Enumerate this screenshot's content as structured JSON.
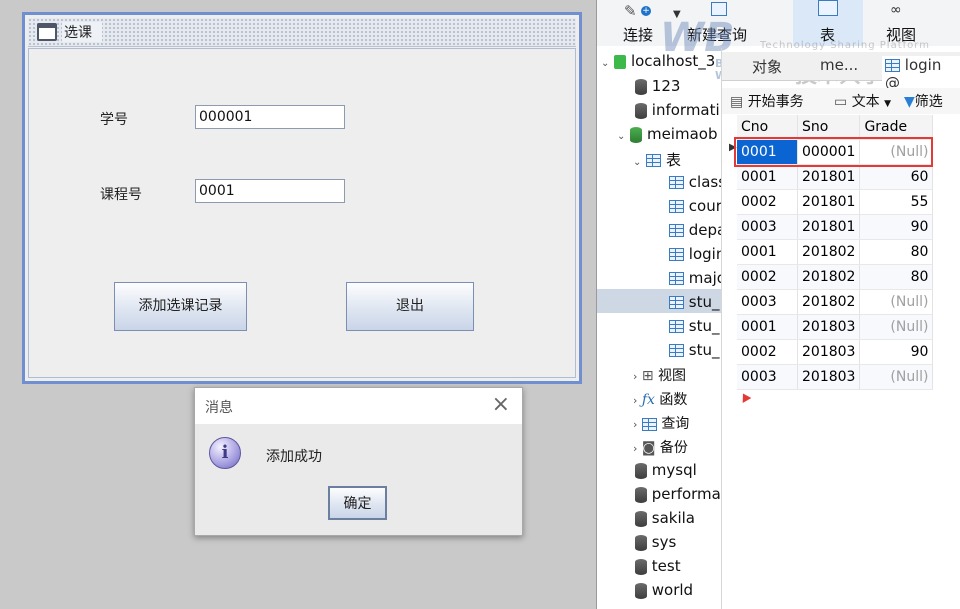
{
  "swing_window": {
    "title": "选课",
    "student_id_label": "学号",
    "student_id_value": "000001",
    "course_id_label": "课程号",
    "course_id_value": "0001",
    "add_button": "添加选课记录",
    "exit_button": "退出"
  },
  "message_dialog": {
    "title": "消息",
    "close_glyph": "×",
    "icon_glyph": "i",
    "message": "添加成功",
    "ok_button": "确定"
  },
  "navicat": {
    "toolbar": {
      "connect": "连接",
      "new_query": "新建查询",
      "table": "表",
      "view": "视图"
    },
    "tabs": {
      "objects": "对象",
      "meimao_tab": "me...",
      "login_tab": "login @"
    },
    "subtoolbar": {
      "begin_transaction": "开始事务",
      "text": "文本",
      "filter": "筛选"
    },
    "tree": {
      "connection": "localhost_3",
      "databases": [
        "123",
        "informati",
        "meimaob"
      ],
      "tables_folder": "表",
      "tables": [
        "class",
        "cour",
        "depa",
        "login",
        "majo",
        "stu_",
        "stu_",
        "stu_"
      ],
      "views": "视图",
      "functions": "函数",
      "queries": "查询",
      "backups": "备份",
      "other_dbs": [
        "mysql",
        "performa",
        "sakila",
        "sys",
        "test",
        "world"
      ]
    },
    "grid": {
      "columns": [
        "Cno",
        "Sno",
        "Grade"
      ],
      "rows": [
        [
          "0001",
          "000001",
          "(Null)"
        ],
        [
          "0001",
          "201801",
          "60"
        ],
        [
          "0002",
          "201801",
          "55"
        ],
        [
          "0003",
          "201801",
          "90"
        ],
        [
          "0001",
          "201802",
          "80"
        ],
        [
          "0002",
          "201802",
          "80"
        ],
        [
          "0003",
          "201802",
          "(Null)"
        ],
        [
          "0001",
          "201803",
          "(Null)"
        ],
        [
          "0002",
          "201803",
          "90"
        ],
        [
          "0003",
          "201803",
          "(Null)"
        ]
      ]
    },
    "watermark": {
      "line1": "Technology Sharing Platform",
      "line2": "技术共享平台",
      "brand1": "WB",
      "brand2": "WRITE",
      "brand3": "BLOG"
    }
  },
  "colors": {
    "highlight_red": "#e53935",
    "selection_blue": "#0a64d2",
    "window_border": "#6f8fd0"
  }
}
